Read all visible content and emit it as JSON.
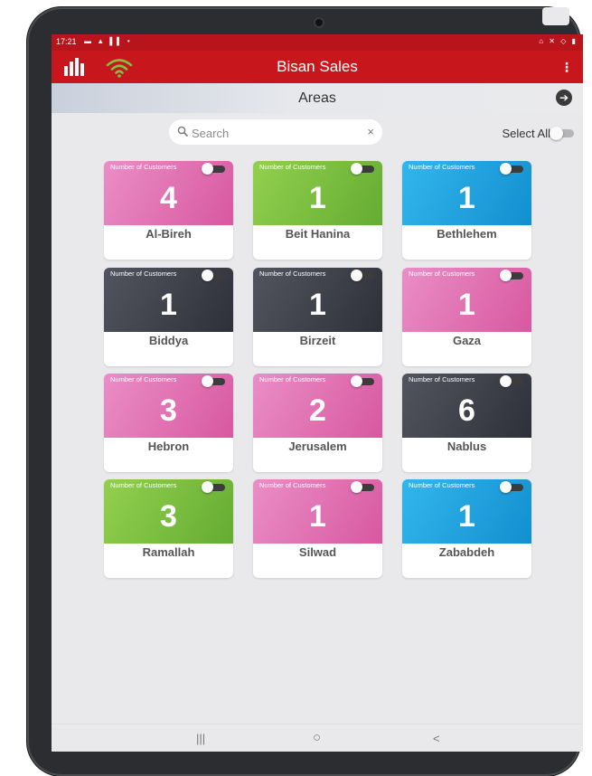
{
  "status_bar": {
    "time": "17:21",
    "left_icons": "▬ ▲ ▌▌ •",
    "right_icons": "⌂ ✕ ◇ ▮"
  },
  "app_bar": {
    "title": "Bisan Sales",
    "menu_icon": "⋮",
    "accent_color": "#c8161d"
  },
  "sub_header": {
    "title": "Areas",
    "arrow_icon": "➔"
  },
  "search": {
    "placeholder": "Search",
    "clear_icon": "×"
  },
  "select_all": {
    "label": "Select All",
    "checked": false
  },
  "card_label": "Number of Customers",
  "cards": [
    {
      "name": "Al-Bireh",
      "count": "4",
      "color": "pink"
    },
    {
      "name": "Beit Hanina",
      "count": "1",
      "color": "green"
    },
    {
      "name": "Bethlehem",
      "count": "1",
      "color": "blue"
    },
    {
      "name": "Biddya",
      "count": "1",
      "color": "dark"
    },
    {
      "name": "Birzeit",
      "count": "1",
      "color": "dark"
    },
    {
      "name": "Gaza",
      "count": "1",
      "color": "pink"
    },
    {
      "name": "Hebron",
      "count": "3",
      "color": "pink"
    },
    {
      "name": "Jerusalem",
      "count": "2",
      "color": "pink"
    },
    {
      "name": "Nablus",
      "count": "6",
      "color": "dark"
    },
    {
      "name": "Ramallah",
      "count": "3",
      "color": "green"
    },
    {
      "name": "Silwad",
      "count": "1",
      "color": "pink"
    },
    {
      "name": "Zababdeh",
      "count": "1",
      "color": "blue"
    }
  ],
  "colors": {
    "pink": "#e477b6",
    "green": "#7dc242",
    "blue": "#1da5e0",
    "dark": "#3a3d47"
  },
  "nav_bar": {
    "recents": "|||",
    "home": "○",
    "back": "<"
  }
}
